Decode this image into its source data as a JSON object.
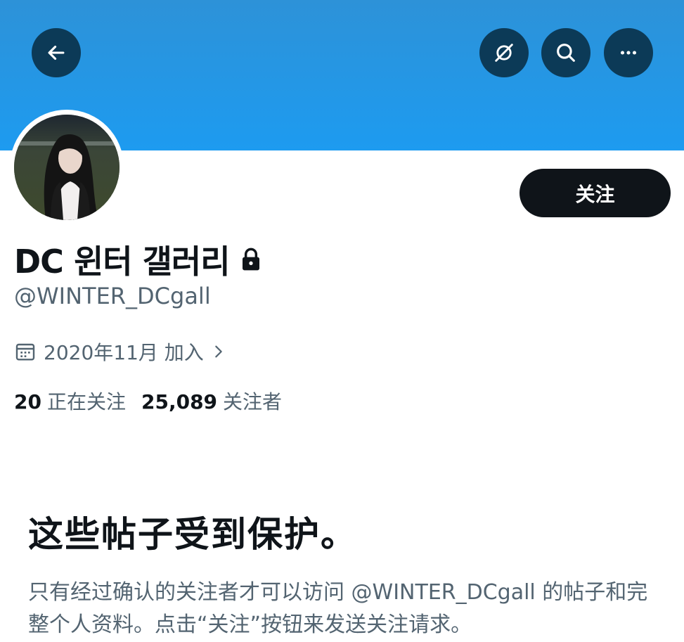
{
  "header": {
    "back_icon": "arrow-left-icon",
    "nofollow_icon": "no-follow-icon",
    "search_icon": "search-icon",
    "more_icon": "more-horizontal-icon",
    "banner_color": "#1d9bf0",
    "button_color": "#0c3a57"
  },
  "profile": {
    "display_name": "DC 윈터 갤러리",
    "lock_icon": "lock-icon",
    "handle": "@WINTER_DCgall",
    "joined": "2020年11月 加入",
    "follow_button": "关注",
    "following_count": "20",
    "following_label": "正在关注",
    "followers_count": "25,089",
    "followers_label": "关注者"
  },
  "protected": {
    "title": "这些帖子受到保护。",
    "description": "只有经过确认的关注者才可以访问 @WINTER_DCgall 的帖子和完整个人资料。点击“关注”按钮来发送关注请求。"
  }
}
